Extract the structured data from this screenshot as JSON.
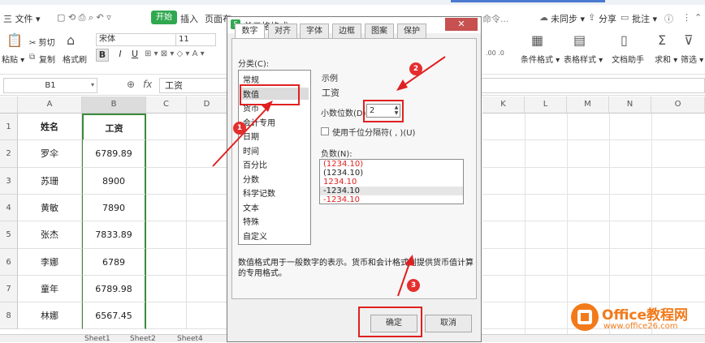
{
  "menubar": {
    "file": "三 文件 ▾",
    "start": "开始",
    "insert": "插入",
    "pagelayout": "页面布",
    "command": "命令...",
    "sync": "未同步 ▾",
    "share": "分享",
    "review": "批注 ▾"
  },
  "ribbon": {
    "paste": "粘贴 ▾",
    "cut": "✂ 剪切",
    "copy": "复制",
    "format_painter": "格式刷",
    "font_name": "宋体",
    "font_size": "11",
    "bold": "B",
    "italic": "I",
    "underline": "U",
    "cond_format": "条件格式 ▾",
    "table_style": "表格样式 ▾",
    "doc_helper": "文档助手",
    "sum": "求和 ▾",
    "filter": "筛选 ▾"
  },
  "formula": {
    "namebox": "B1",
    "fx": "fx",
    "value": "工资"
  },
  "columns": [
    "A",
    "B",
    "C",
    "D",
    "K",
    "L",
    "M",
    "N",
    "O"
  ],
  "rows": [
    {
      "num": "1",
      "name": "姓名",
      "salary": "工资"
    },
    {
      "num": "2",
      "name": "罗伞",
      "salary": "6789.89"
    },
    {
      "num": "3",
      "name": "苏珊",
      "salary": "8900"
    },
    {
      "num": "4",
      "name": "黄敏",
      "salary": "7890"
    },
    {
      "num": "5",
      "name": "张杰",
      "salary": "7833.89"
    },
    {
      "num": "6",
      "name": "李娜",
      "salary": "6789"
    },
    {
      "num": "7",
      "name": "童年",
      "salary": "6789.98"
    },
    {
      "num": "8",
      "name": "林娜",
      "salary": "6567.45"
    }
  ],
  "sheets": [
    "Sheet1",
    "Sheet2",
    "Sheet4"
  ],
  "dialog": {
    "title": "单元格格式",
    "close": "✕",
    "tabs": [
      "数字",
      "对齐",
      "字体",
      "边框",
      "图案",
      "保护"
    ],
    "category_label": "分类(C):",
    "categories": [
      "常规",
      "数值",
      "货币",
      "会计专用",
      "日期",
      "时间",
      "百分比",
      "分数",
      "科学记数",
      "文本",
      "特殊",
      "自定义"
    ],
    "sample_label": "示例",
    "sample_value": "工资",
    "decimal_label": "小数位数(D):",
    "decimal_value": "2",
    "thousands_label": "使用千位分隔符( , )(U)",
    "negative_label": "负数(N):",
    "negatives": [
      "(1234.10)",
      "(1234.10)",
      "1234.10",
      "-1234.10",
      "-1234.10"
    ],
    "description": "数值格式用于一般数字的表示。货币和会计格式则提供货币值计算的专用格式。",
    "ok": "确定",
    "cancel": "取消"
  },
  "annotations": [
    "1",
    "2",
    "3"
  ],
  "watermark": {
    "brand": "Office教程网",
    "url": "www.office26.com"
  },
  "colors": {
    "accent_green": "#2fa84f",
    "annotation_red": "#e02020",
    "negative_red": "#e02020",
    "logo_orange": "#f27a1a"
  }
}
